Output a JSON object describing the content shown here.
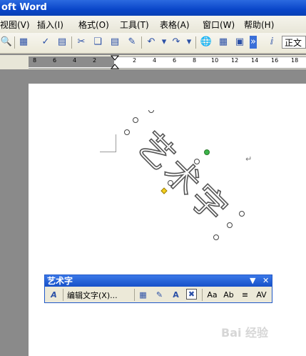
{
  "window": {
    "title": "oft Word"
  },
  "menu": {
    "items": [
      "视图(V)",
      "插入(I)",
      "格式(O)",
      "工具(T)",
      "表格(A)",
      "窗口(W)",
      "帮助(H)"
    ]
  },
  "toolbar": {
    "style_value": "正文"
  },
  "ruler": {
    "ticks": [
      "8",
      "6",
      "4",
      "2",
      "2",
      "4",
      "6",
      "8",
      "10",
      "12",
      "14",
      "16",
      "18"
    ]
  },
  "wordart": {
    "text": "艺术字"
  },
  "wordart_toolbar": {
    "title": "艺术字",
    "edit_label": "编辑文字(X)...",
    "buttons": [
      "wordart-gallery-icon",
      "format-wordart-icon",
      "wordart-shape-icon",
      "text-wrapping-icon",
      "same-letter-heights-icon",
      "vertical-text-icon",
      "alignment-icon",
      "character-spacing-icon"
    ]
  },
  "watermark": {
    "text": "Bai 经验"
  }
}
